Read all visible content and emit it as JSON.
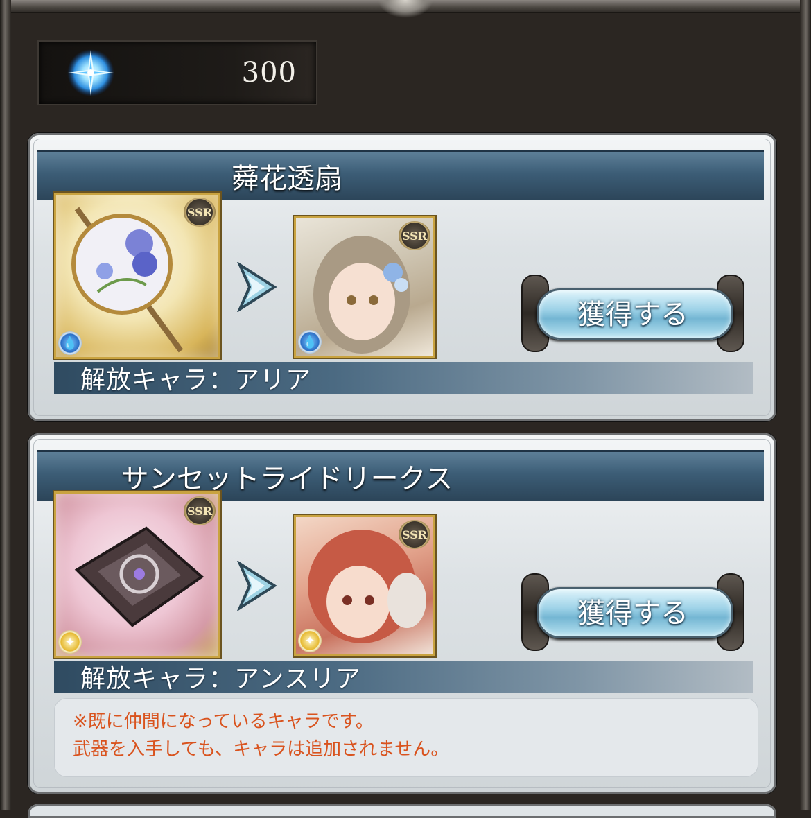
{
  "currency": {
    "amount": "300",
    "icon": "crystal-icon"
  },
  "cards": [
    {
      "title": "蕣花透扇",
      "weapon_rarity": "SSR",
      "character_rarity": "SSR",
      "element": "water",
      "button_label": "獲得する",
      "release_text": "解放キャラ：アリア"
    },
    {
      "title": "サンセットライドリークス",
      "weapon_rarity": "SSR",
      "character_rarity": "SSR",
      "element": "light",
      "button_label": "獲得する",
      "release_text": "解放キャラ：アンスリア",
      "note_line1": "※既に仲間になっているキャラです。",
      "note_line2": "武器を入手しても、キャラは追加されません。"
    }
  ],
  "colors": {
    "title_bar": "#3c5d76",
    "note_text": "#d9531e",
    "background": "#2b2622"
  }
}
